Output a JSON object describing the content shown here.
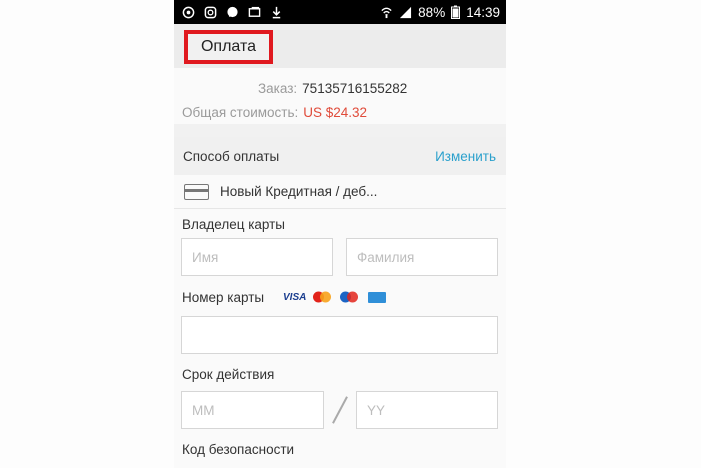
{
  "status_bar": {
    "battery_percent": "88%",
    "time": "14:39",
    "icons": [
      "whatsapp-icon",
      "instagram-icon",
      "messenger-icon",
      "gallery-icon",
      "download-icon",
      "wifi-icon",
      "signal-icon",
      "battery-icon"
    ]
  },
  "header": {
    "title": "Оплата"
  },
  "annotation": {
    "arrow_color": "#e0191f",
    "highlight_color": "#e0191f"
  },
  "order": {
    "number_label": "Заказ:",
    "number_value": "75135716155282",
    "total_label": "Общая стоимость:",
    "total_value": "US $24.32"
  },
  "payment_method": {
    "label": "Способ оплаты",
    "change_link": "Изменить",
    "selected": "Новый Кредитная / деб..."
  },
  "form": {
    "cardholder_label": "Владелец карты",
    "first_name_placeholder": "Имя",
    "last_name_placeholder": "Фамилия",
    "card_number_label": "Номер карты",
    "card_brands": [
      "visa",
      "mastercard",
      "maestro",
      "amex"
    ],
    "visa_text": "VISA",
    "expiry_label": "Срок действия",
    "month_placeholder": "MM",
    "year_placeholder": "YY",
    "security_code_label": "Код безопасности"
  },
  "colors": {
    "accent_link": "#2aa0cc",
    "price": "#e04b3a"
  }
}
